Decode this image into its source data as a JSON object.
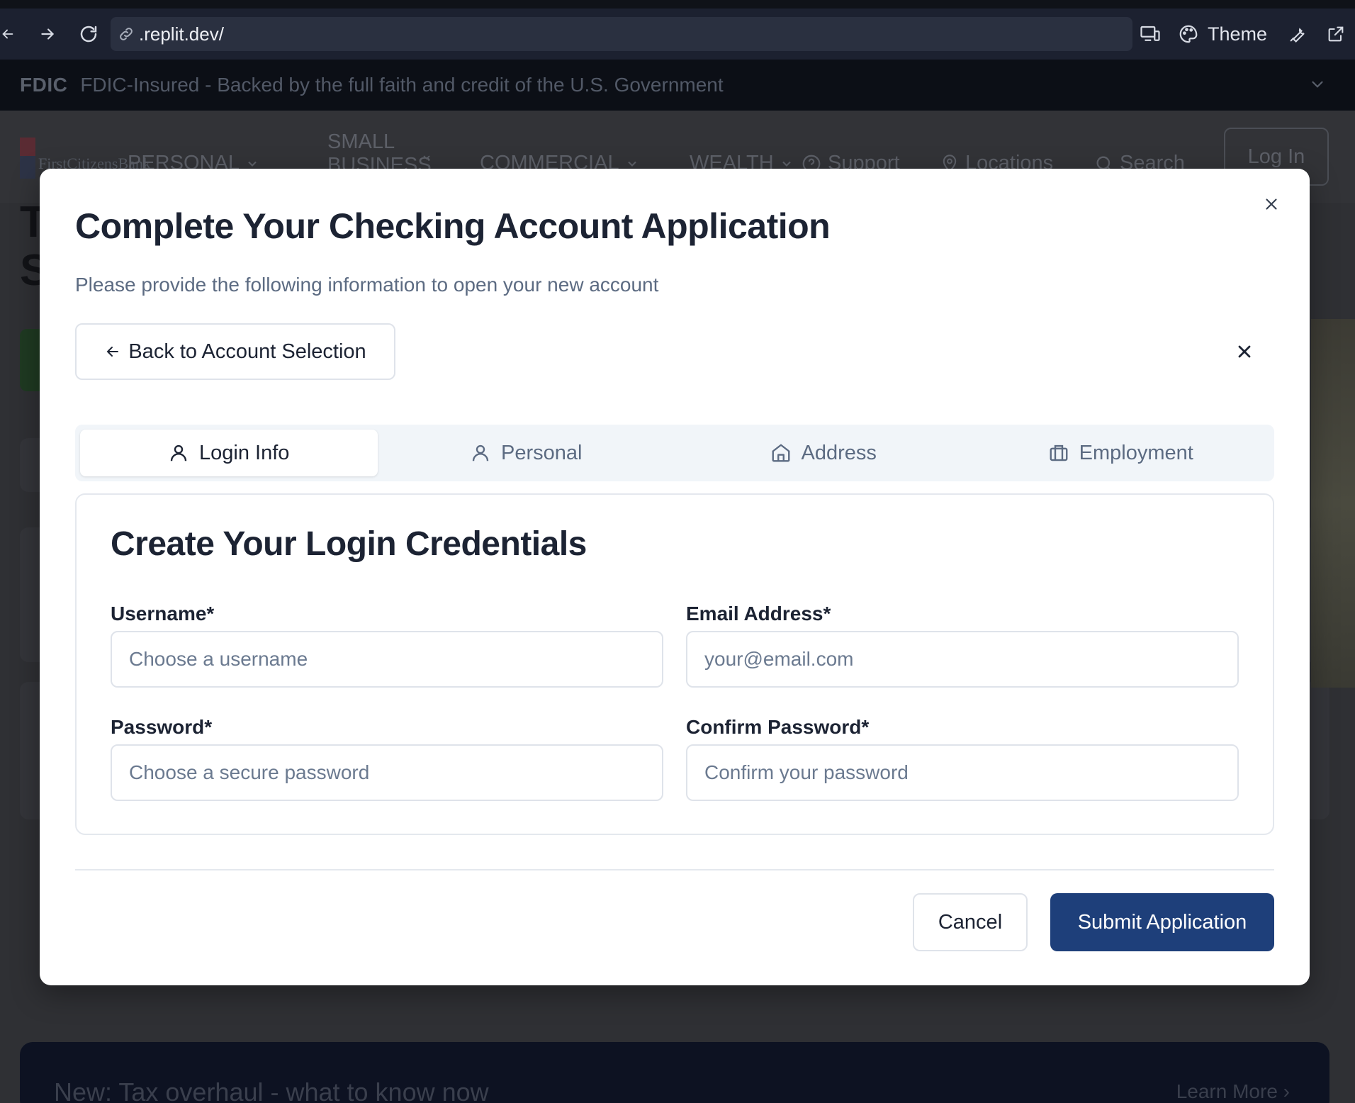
{
  "browser": {
    "url": ".replit.dev/",
    "theme_label": "Theme"
  },
  "background_page": {
    "fdic_logo": "FDIC",
    "fdic_text": "FDIC-Insured - Backed by the full faith and credit of the U.S. Government",
    "logo_text": "FirstCitizensBank",
    "nav": {
      "personal": "PERSONAL",
      "small_business_line1": "SMALL",
      "small_business_line2": "BUSINESS",
      "commercial": "COMMERCIAL",
      "wealth": "WEALTH",
      "support": "Support",
      "locations": "Locations",
      "search": "Search",
      "login": "Log In"
    },
    "hero_letter_1": "T",
    "hero_letter_2": "S",
    "banner_text": "New: Tax overhaul - what to know now",
    "banner_link": "Learn More ›"
  },
  "modal": {
    "title": "Complete Your Checking Account Application",
    "subtitle": "Please provide the following information to open your new account",
    "back_button": "Back to Account Selection",
    "tabs": [
      {
        "label": "Login Info",
        "icon": "user-icon",
        "active": true
      },
      {
        "label": "Personal",
        "icon": "user-icon",
        "active": false
      },
      {
        "label": "Address",
        "icon": "home-icon",
        "active": false
      },
      {
        "label": "Employment",
        "icon": "briefcase-icon",
        "active": false
      }
    ],
    "section_title": "Create Your Login Credentials",
    "fields": {
      "username": {
        "label": "Username*",
        "placeholder": "Choose a username",
        "value": ""
      },
      "email": {
        "label": "Email Address*",
        "placeholder": "your@email.com",
        "value": ""
      },
      "password": {
        "label": "Password*",
        "placeholder": "Choose a secure password",
        "value": ""
      },
      "confirm_password": {
        "label": "Confirm Password*",
        "placeholder": "Confirm your password",
        "value": ""
      }
    },
    "cancel_button": "Cancel",
    "submit_button": "Submit Application"
  },
  "colors": {
    "primary_button": "#1e3f7a",
    "overlay": "#2f3034",
    "heading_text": "#1c2333",
    "muted_text": "#5c6b82"
  }
}
